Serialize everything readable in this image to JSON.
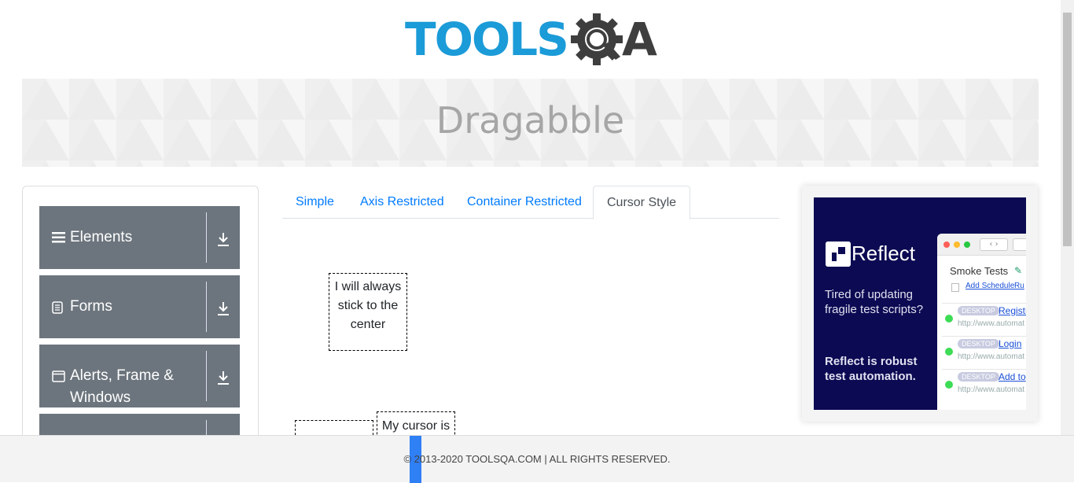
{
  "header": {
    "logo_text": "TOOLS",
    "logo_text_tail": "A",
    "logo_icon": "gear-magnifier-icon"
  },
  "banner": {
    "title": "Dragabble"
  },
  "sidebar": {
    "groups": [
      {
        "label": "Elements",
        "icon": "hamburger-icon"
      },
      {
        "label": "Forms",
        "icon": "form-icon"
      },
      {
        "label": "Alerts, Frame & Windows",
        "icon": "window-icon"
      },
      {
        "label": "",
        "icon": ""
      }
    ]
  },
  "tabs": [
    {
      "label": "Simple",
      "active": false
    },
    {
      "label": "Axis Restricted",
      "active": false
    },
    {
      "label": "Container Restricted",
      "active": false
    },
    {
      "label": "Cursor Style",
      "active": true
    }
  ],
  "draggables": {
    "center": "I will always stick to the center",
    "top_left": "",
    "bottom": "My cursor is"
  },
  "ad": {
    "brand": "Reflect",
    "headline": "Tired of updating fragile test scripts?",
    "tagline": "Reflect is robust test automation.",
    "window_title": "Smoke Tests",
    "add_schedule": "Add Schedule",
    "run_link": "Ru",
    "rows": [
      {
        "tag": "DESKTOP",
        "name": "Registr",
        "url": "http://www.automat"
      },
      {
        "tag": "DESKTOP",
        "name": "Login",
        "url": "http://www.automat"
      },
      {
        "tag": "DESKTOP",
        "name": "Add to",
        "url": "http://www.automat"
      }
    ],
    "bg_color": "#0c0a52"
  },
  "footer": {
    "text": "© 2013-2020 TOOLSQA.COM | ALL RIGHTS RESERVED."
  },
  "colors": {
    "accent": "#007bff",
    "sidebar_group": "#6c757d",
    "logo_blue": "#1b9bd8"
  }
}
